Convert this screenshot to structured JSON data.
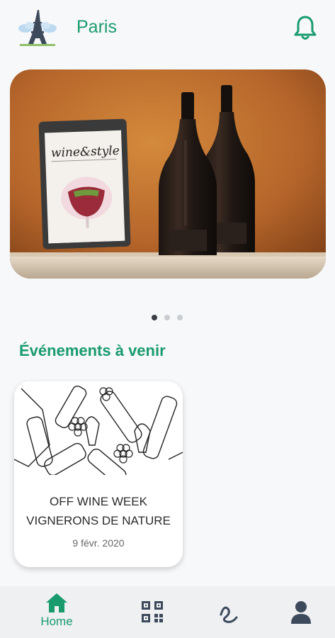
{
  "header": {
    "city": "Paris",
    "logo_icon": "eiffel-tower-icon",
    "notification_icon": "bell-icon"
  },
  "carousel": {
    "slide_count": 3,
    "active_index": 0,
    "magazine_title": "wine&style"
  },
  "events": {
    "section_title": "Événements à venir",
    "items": [
      {
        "title_line1": "OFF WINE WEEK",
        "title_line2": "VIGNERONS DE NATURE",
        "date": "9 févr. 2020"
      }
    ]
  },
  "tabbar": {
    "items": [
      {
        "label": "Home",
        "icon": "home-icon",
        "active": true
      },
      {
        "label": "",
        "icon": "qr-code-icon",
        "active": false
      },
      {
        "label": "",
        "icon": "squiggle-icon",
        "active": false
      },
      {
        "label": "",
        "icon": "user-icon",
        "active": false
      }
    ]
  },
  "colors": {
    "accent": "#1a9b6e",
    "background": "#f7f8f9",
    "tabbar": "#eef0f2"
  }
}
